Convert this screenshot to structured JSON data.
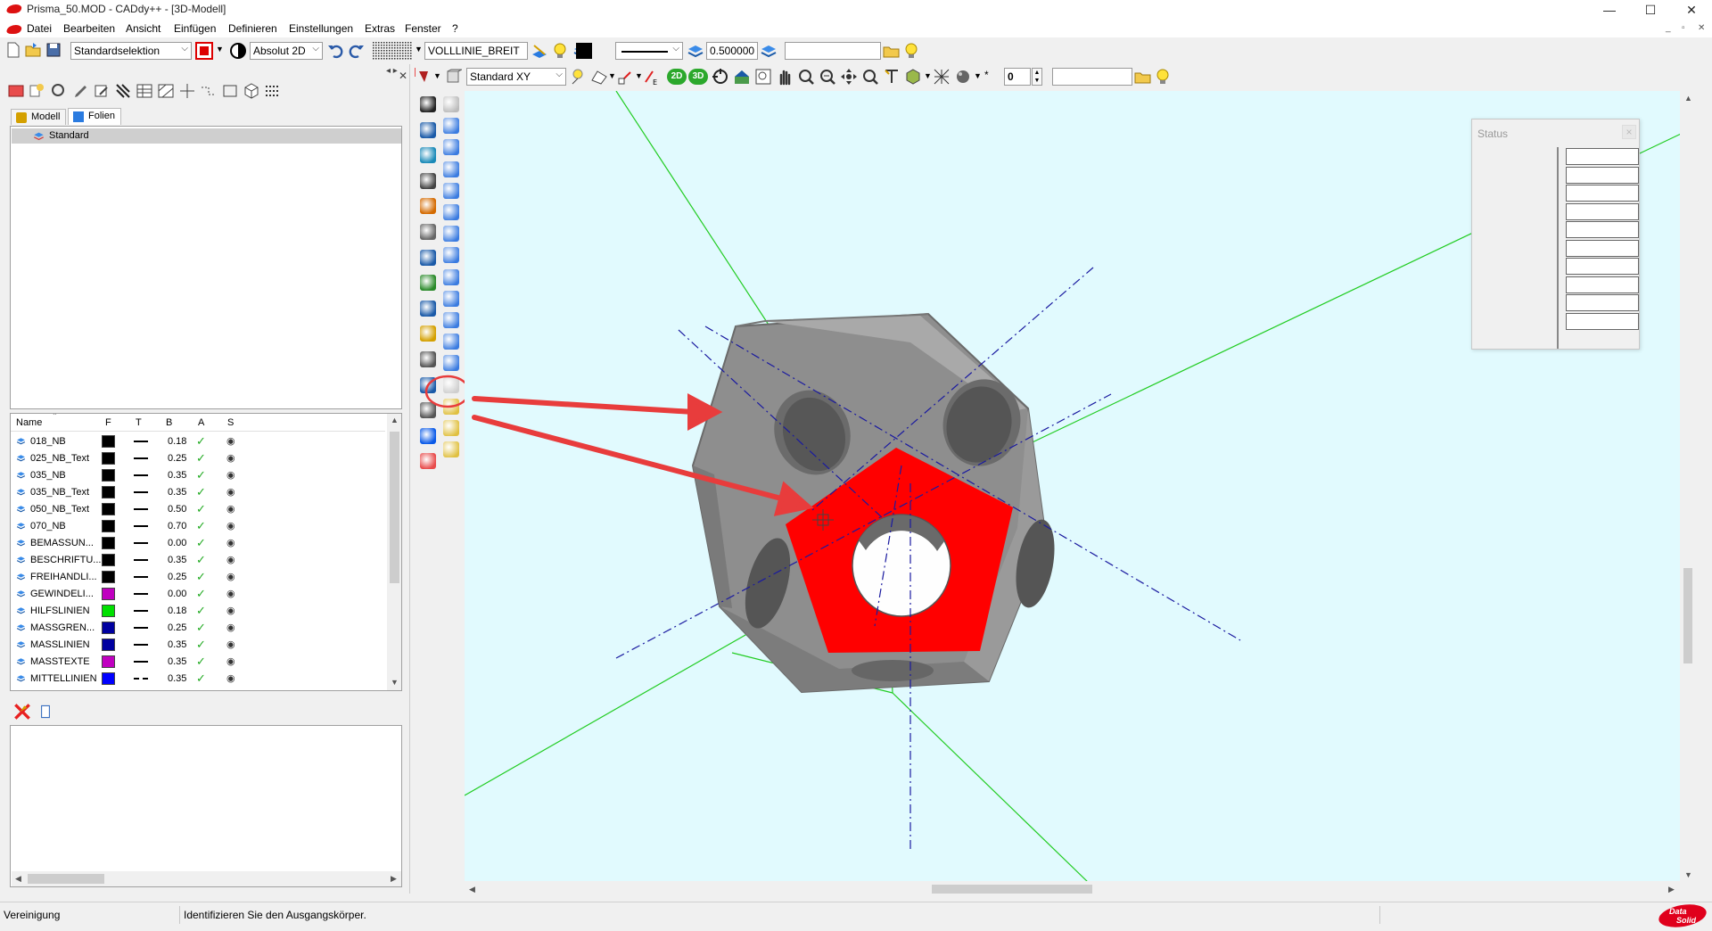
{
  "window": {
    "title": "Prisma_50.MOD  - CADdy++ - [3D-Modell]",
    "buttons": [
      "—",
      "☐",
      "✕"
    ]
  },
  "menu": {
    "items": [
      "Datei",
      "Bearbeiten",
      "Ansicht",
      "Einfügen",
      "Definieren",
      "Einstellungen",
      "Extras",
      "Fenster",
      "?"
    ],
    "mdi_buttons": [
      "_",
      "▫",
      "✕"
    ]
  },
  "toolbar1": {
    "selection_mode": "Standardselektion",
    "coord_mode": "Absolut 2D",
    "linetype": "VOLLLINIE_BREIT",
    "line_width": "0.500000",
    "text_field": ""
  },
  "toolbar2": {
    "view_name": "Standard XY",
    "btn_2d": "2D",
    "btn_3d": "3D",
    "layer_number": "0",
    "text_field": ""
  },
  "left_panel": {
    "tabs": [
      "Modell",
      "Folien"
    ],
    "active_tab": "Folien",
    "tree_items": [
      "Standard"
    ],
    "columns": [
      "Name",
      "F",
      "T",
      "B",
      "A",
      "S"
    ],
    "layers": [
      {
        "name": "018_NB",
        "color": "#000000",
        "line": "solid",
        "width": "0.18"
      },
      {
        "name": "025_NB_Text",
        "color": "#000000",
        "line": "solid",
        "width": "0.25"
      },
      {
        "name": "035_NB",
        "color": "#000000",
        "line": "solid",
        "width": "0.35"
      },
      {
        "name": "035_NB_Text",
        "color": "#000000",
        "line": "solid",
        "width": "0.35"
      },
      {
        "name": "050_NB_Text",
        "color": "#000000",
        "line": "solid",
        "width": "0.50"
      },
      {
        "name": "070_NB",
        "color": "#000000",
        "line": "solid",
        "width": "0.70"
      },
      {
        "name": "BEMASSUN...",
        "color": "#000000",
        "line": "solid",
        "width": "0.00"
      },
      {
        "name": "BESCHRIFTU...",
        "color": "#000000",
        "line": "solid",
        "width": "0.35"
      },
      {
        "name": "FREIHANDLI...",
        "color": "#000000",
        "line": "solid",
        "width": "0.25"
      },
      {
        "name": "GEWINDELI...",
        "color": "#c000c0",
        "line": "solid",
        "width": "0.00"
      },
      {
        "name": "HILFSLINIEN",
        "color": "#00e000",
        "line": "solid",
        "width": "0.18"
      },
      {
        "name": "MASSGREN...",
        "color": "#0000a0",
        "line": "solid",
        "width": "0.25"
      },
      {
        "name": "MASSLINIEN",
        "color": "#0000a0",
        "line": "solid",
        "width": "0.35"
      },
      {
        "name": "MASSTEXTE",
        "color": "#c000c0",
        "line": "solid",
        "width": "0.35"
      },
      {
        "name": "MITTELLINIEN",
        "color": "#0000ff",
        "line": "dash",
        "width": "0.35"
      }
    ]
  },
  "status_panel": {
    "title": "Status",
    "close": "×"
  },
  "statusbar": {
    "command": "Vereinigung",
    "prompt": "Identifizieren Sie den Ausgangskörper.",
    "logo_line1": "Data",
    "logo_line2": "Solid"
  },
  "colors": {
    "viewport_bg": "#e1fafe",
    "solid_face": "#8c8c8c",
    "selected_face": "#ff0000",
    "axis_green": "#22cc22",
    "center_lines": "#1a1aa0",
    "annotation_arrow": "#e83c3c"
  }
}
